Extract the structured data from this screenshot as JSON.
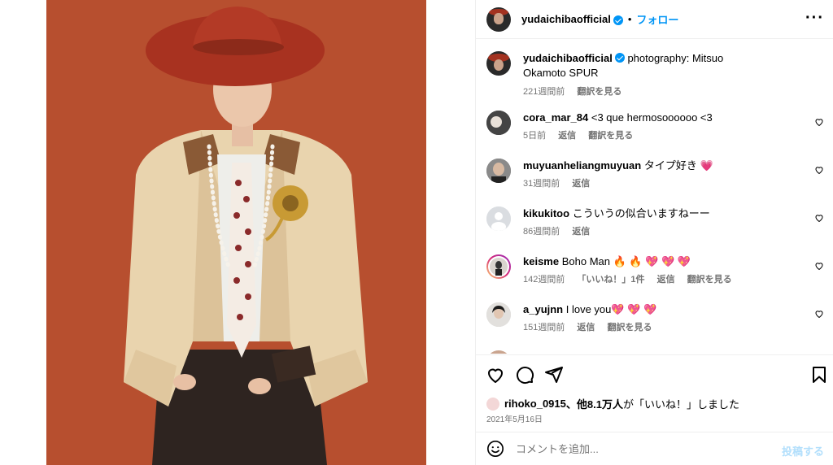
{
  "post": {
    "username": "yudaichibaofficial",
    "follow_label": "フォロー",
    "more_label": "···"
  },
  "caption": {
    "username": "yudaichibaofficial",
    "text": "photography: Mitsuo Okamoto SPUR",
    "time": "221週間前",
    "translate": "翻訳を見る"
  },
  "comments": [
    {
      "username": "cora_mar_84",
      "text": "<3 que hermosoooooo <3",
      "time": "5日前",
      "reply": "返信",
      "translate": "翻訳を見る"
    },
    {
      "username": "muyuanheliangmuyuan",
      "text": "タイプ好き 💗",
      "time": "31週間前",
      "reply": "返信"
    },
    {
      "username": "kikukitoo",
      "text": "こういうの似合いますねーー",
      "time": "86週間前",
      "reply": "返信"
    },
    {
      "username": "keisme",
      "text": "Boho Man 🔥 🔥 💖 💖 💖",
      "time": "142週間前",
      "likes": "「いいね！」1件",
      "reply": "返信",
      "translate": "翻訳を見る"
    },
    {
      "username": "a_yujnn",
      "text": "I love you💖 💖 💖",
      "time": "151週間前",
      "reply": "返信",
      "translate": "翻訳を見る"
    }
  ],
  "likes": {
    "user": "rihoko_0915",
    "rest": "、他",
    "count": "8.1万人",
    "suffix": "が「いいね！」しました"
  },
  "date": "2021年5月16日",
  "add_comment": {
    "placeholder": "コメントを追加...",
    "post_label": "投稿する"
  },
  "colors": {
    "accent": "#0095f6",
    "photo_bg": "#b54a2c",
    "post_disabled": "#b2dffc"
  }
}
